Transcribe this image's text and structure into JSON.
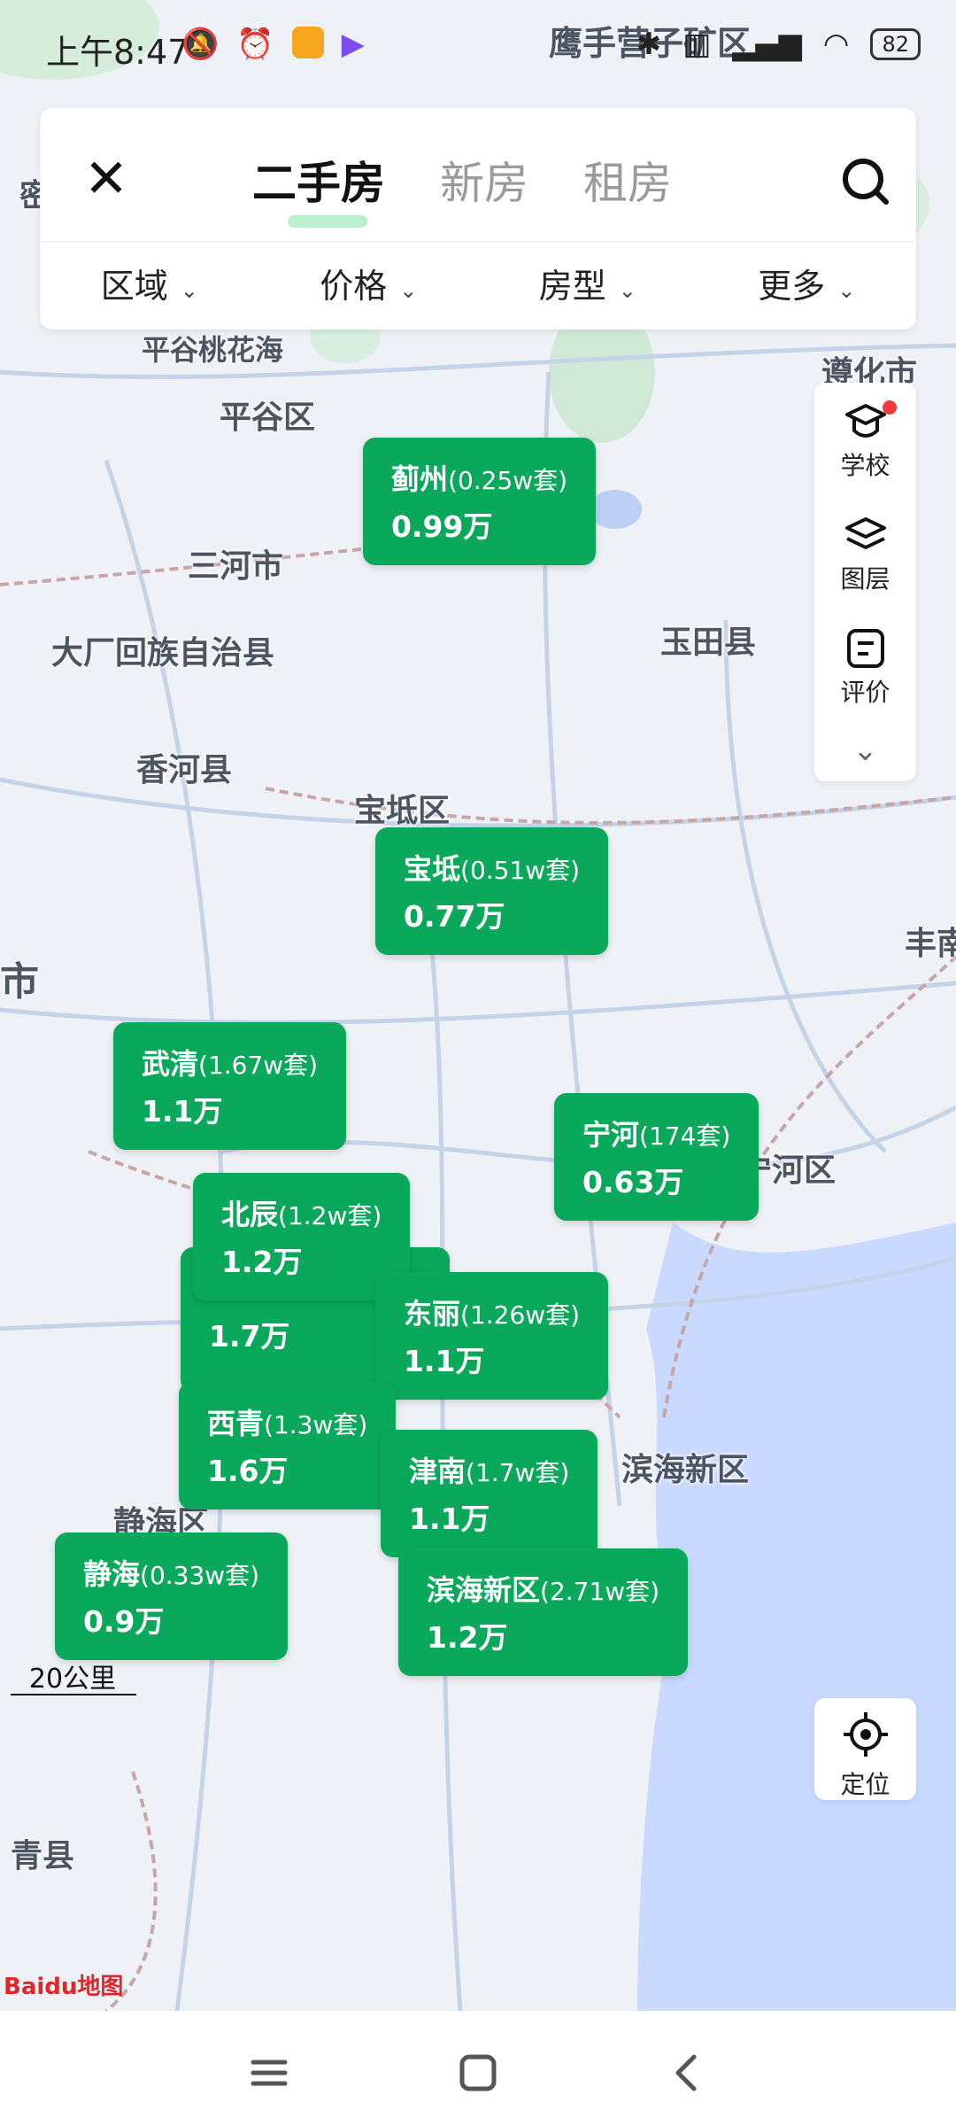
{
  "status_bar": {
    "time": "上午8:47",
    "overlay_place": "鹰手营子矿区",
    "battery": "82",
    "icons": [
      "mute-icon",
      "alarm-icon",
      "app1-icon",
      "app2-icon",
      "bluetooth-icon",
      "sim-off-icon",
      "signal-icon",
      "wifi-icon"
    ]
  },
  "header": {
    "close_icon": "close-icon",
    "tabs": [
      {
        "label": "二手房",
        "active": true
      },
      {
        "label": "新房",
        "active": false
      },
      {
        "label": "租房",
        "active": false
      }
    ],
    "search_icon": "search-icon",
    "filters": [
      {
        "label": "区域"
      },
      {
        "label": "价格"
      },
      {
        "label": "房型"
      },
      {
        "label": "更多"
      }
    ]
  },
  "map_labels": {
    "pinggu_taohuahai": "平谷桃花海",
    "pinggu": "平谷区",
    "zunhua": "遵化市",
    "sanhe": "三河市",
    "dachang": "大厂回族自治县",
    "yutian": "玉田县",
    "xianghe": "香河县",
    "baodi": "宝坻区",
    "fengnan": "丰南",
    "shi": "市",
    "ninghe": "宁河区",
    "binhai": "滨海新区",
    "jinghai": "静海区",
    "qingxian": "青县",
    "mi": "密"
  },
  "pins": [
    {
      "name": "蓟州",
      "count": "(0.25w套)",
      "price": "0.99万"
    },
    {
      "name": "宝坻",
      "count": "(0.51w套)",
      "price": "0.77万"
    },
    {
      "name": "武清",
      "count": "(1.67w套)",
      "price": "1.1万"
    },
    {
      "name": "宁河",
      "count": "(174套)",
      "price": "0.63万"
    },
    {
      "name": "",
      "count": "",
      "price": "1.7万"
    },
    {
      "name": "北辰",
      "count": "(1.2w套)",
      "price": "1.2万"
    },
    {
      "name": "东丽",
      "count": "(1.26w套)",
      "price": "1.1万"
    },
    {
      "name": "西青",
      "count": "(1.3w套)",
      "price": "1.6万"
    },
    {
      "name": "津南",
      "count": "(1.7w套)",
      "price": "1.1万"
    },
    {
      "name": "静海",
      "count": "(0.33w套)",
      "price": "0.9万"
    },
    {
      "name": "滨海新区",
      "count": "(2.71w套)",
      "price": "1.2万"
    }
  ],
  "side_tools": [
    {
      "label": "学校",
      "icon": "graduation-cap-icon",
      "badge": true
    },
    {
      "label": "图层",
      "icon": "layers-icon"
    },
    {
      "label": "评价",
      "icon": "review-icon"
    }
  ],
  "side_expand_icon": "chevron-down-icon",
  "locate": {
    "label": "定位",
    "icon": "locate-icon"
  },
  "scale": "20公里",
  "brand": "Baidu地图",
  "colors": {
    "pin_green": "#0aa85a",
    "active_tab_underline": "#b9efcd",
    "sea_blue": "#c9d9ff",
    "badge_red": "#ee3b3b"
  }
}
